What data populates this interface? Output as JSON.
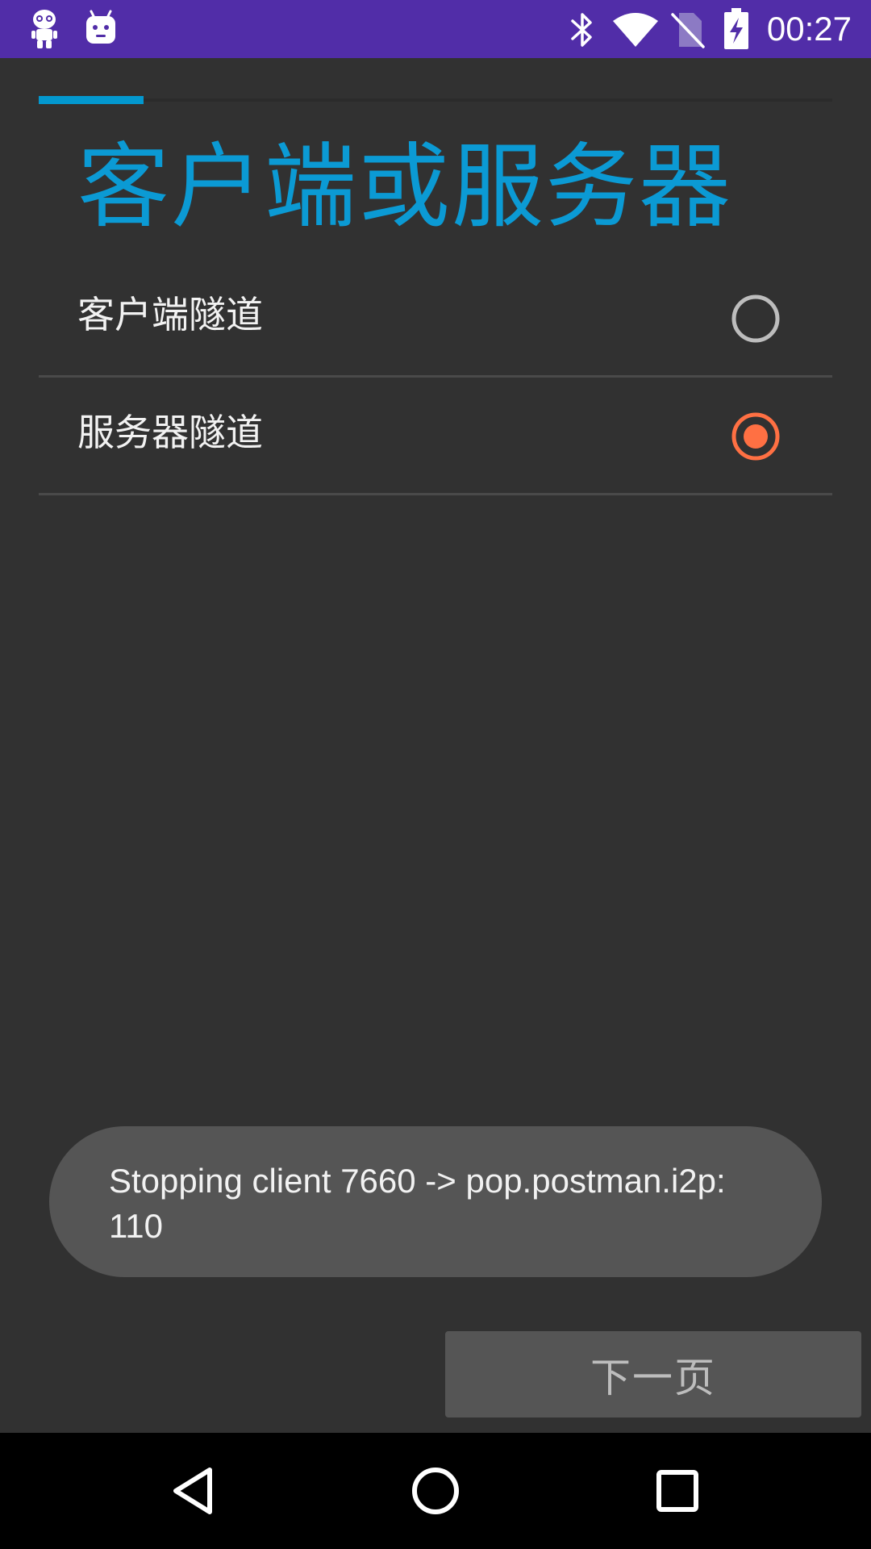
{
  "status_bar": {
    "time": "00:27",
    "background": "#512da8",
    "icons": [
      "i2p-robot-icon",
      "android-icon",
      "bluetooth-icon",
      "wifi-icon",
      "no-sim-icon",
      "battery-charging-icon"
    ]
  },
  "stepper": {
    "current_step": 1,
    "accent": "#0398cf"
  },
  "page": {
    "title": "客户端或服务器",
    "title_color": "#0b9ad4"
  },
  "options": [
    {
      "label": "客户端隧道",
      "selected": false
    },
    {
      "label": "服务器隧道",
      "selected": true
    }
  ],
  "radio_colors": {
    "selected": "#ff7043",
    "unselected": "#bdbdbd"
  },
  "toast": {
    "text": "Stopping client 7660 -> pop.postman.i2p: 110"
  },
  "next_button": {
    "label": "下一页"
  },
  "nav_bar": {
    "icons": [
      "back-icon",
      "home-icon",
      "recents-icon"
    ]
  }
}
